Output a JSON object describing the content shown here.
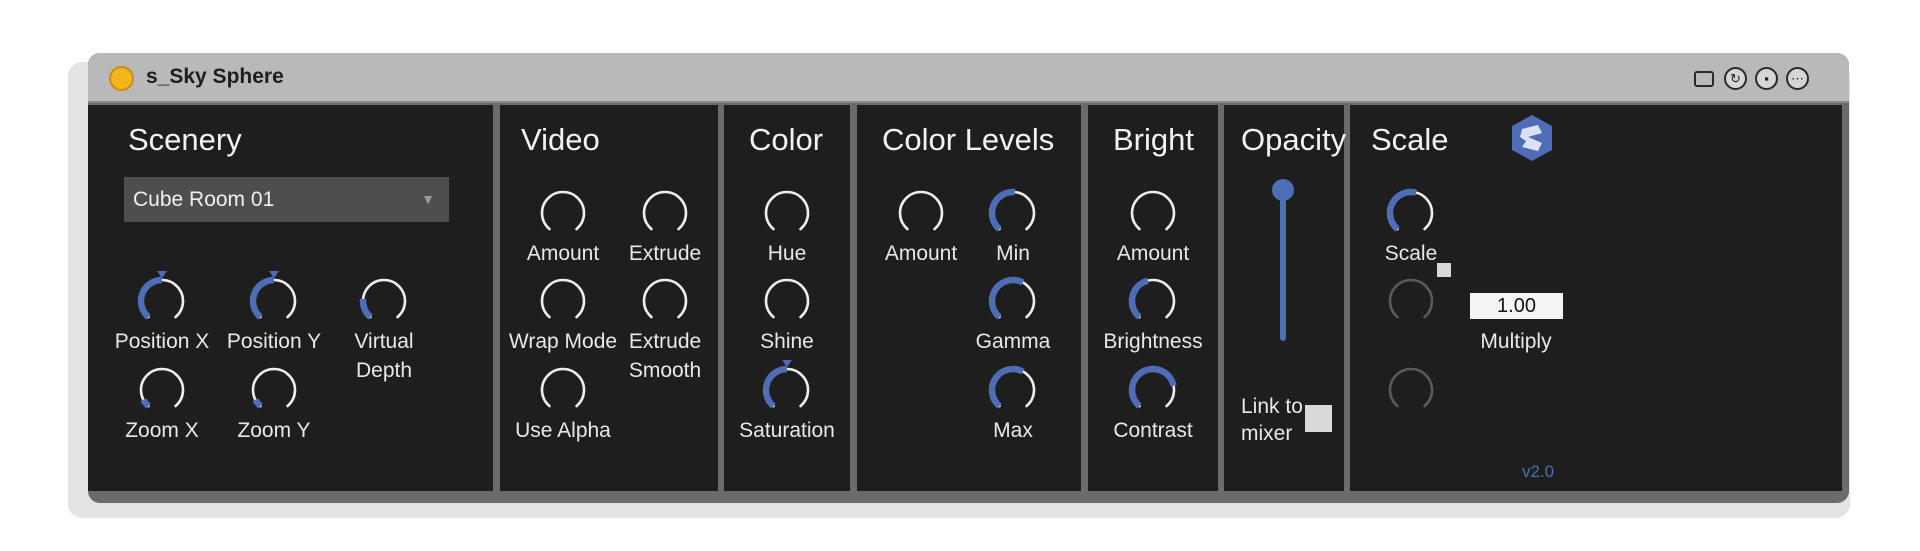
{
  "window": {
    "title": "s_Sky Sphere",
    "title_icons": [
      "window-icon",
      "sync-icon",
      "save-icon",
      "more-icon"
    ],
    "colors": {
      "accent": "#4e6db6",
      "panel": "#1e1e1e",
      "titlebar": "#b9b9b9",
      "title_dot": "#f2b81b"
    }
  },
  "sections": {
    "scenery": {
      "title": "Scenery",
      "dropdown_value": "Cube Room 01",
      "knobs": {
        "position_x": "Position X",
        "position_y": "Position Y",
        "virtual_depth_1": "Virtual",
        "virtual_depth_2": "Depth",
        "zoom_x": "Zoom X",
        "zoom_y": "Zoom Y"
      }
    },
    "video": {
      "title": "Video",
      "knobs": {
        "amount": "Amount",
        "extrude": "Extrude",
        "wrap_mode": "Wrap Mode",
        "extrude_smooth_1": "Extrude",
        "extrude_smooth_2": "Smooth",
        "use_alpha": "Use Alpha"
      }
    },
    "color": {
      "title": "Color",
      "knobs": {
        "hue": "Hue",
        "shine": "Shine",
        "saturation": "Saturation"
      }
    },
    "color_levels": {
      "title": "Color Levels",
      "knobs": {
        "amount": "Amount",
        "min": "Min",
        "gamma": "Gamma",
        "max": "Max"
      }
    },
    "bright": {
      "title": "Bright",
      "knobs": {
        "amount": "Amount",
        "brightness": "Brightness",
        "contrast": "Contrast"
      }
    },
    "opacity": {
      "title": "Opacity",
      "link_label_1": "Link to",
      "link_label_2": "mixer",
      "slider_level": 1.0
    },
    "scale": {
      "title": "Scale",
      "scale_label": "Scale",
      "multiply_value": "1.00",
      "multiply_label": "Multiply",
      "version": "v2.0",
      "logo_icon": "brand-logo-icon"
    }
  }
}
